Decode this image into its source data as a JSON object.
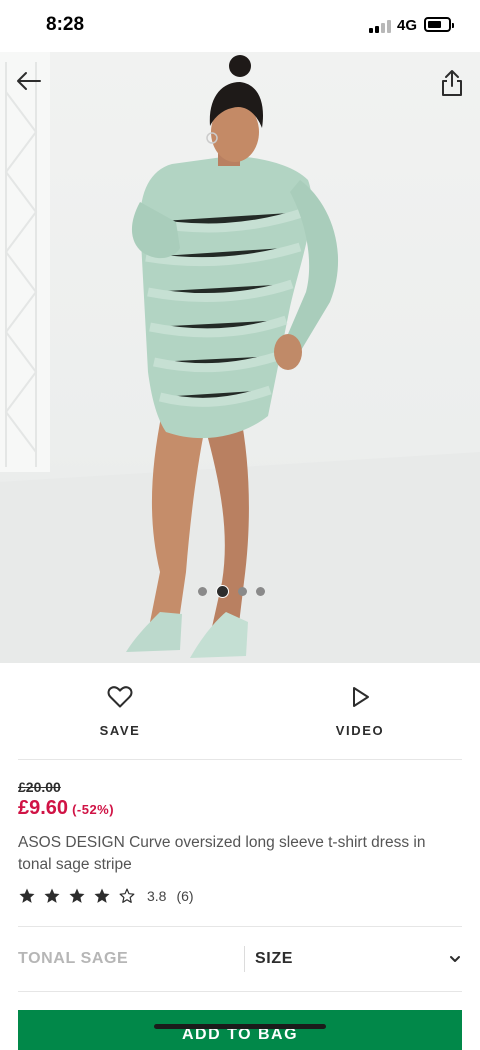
{
  "status_bar": {
    "time": "8:28",
    "network": "4G"
  },
  "icons": {
    "back": "arrow-left-icon",
    "share": "share-icon",
    "save": "heart-icon",
    "video": "play-icon",
    "size": "chevron-down-icon"
  },
  "gallery": {
    "image_count": 4,
    "active_index": 1
  },
  "actions": {
    "save_label": "SAVE",
    "video_label": "VIDEO"
  },
  "product": {
    "was_price": "£20.00",
    "now_price": "£9.60",
    "discount": "(-52%)",
    "title": "ASOS DESIGN Curve oversized long sleeve t-shirt dress in tonal sage stripe",
    "rating": {
      "value": "3.8",
      "count": "(6)",
      "stars_filled": 4,
      "stars_total": 5
    }
  },
  "selectors": {
    "colour": "TONAL SAGE",
    "size_label": "SIZE"
  },
  "cta": {
    "add_to_bag": "ADD TO BAG"
  },
  "colors": {
    "price_sale": "#d01345",
    "add_button": "#018849",
    "text": "#2d2d2d"
  }
}
